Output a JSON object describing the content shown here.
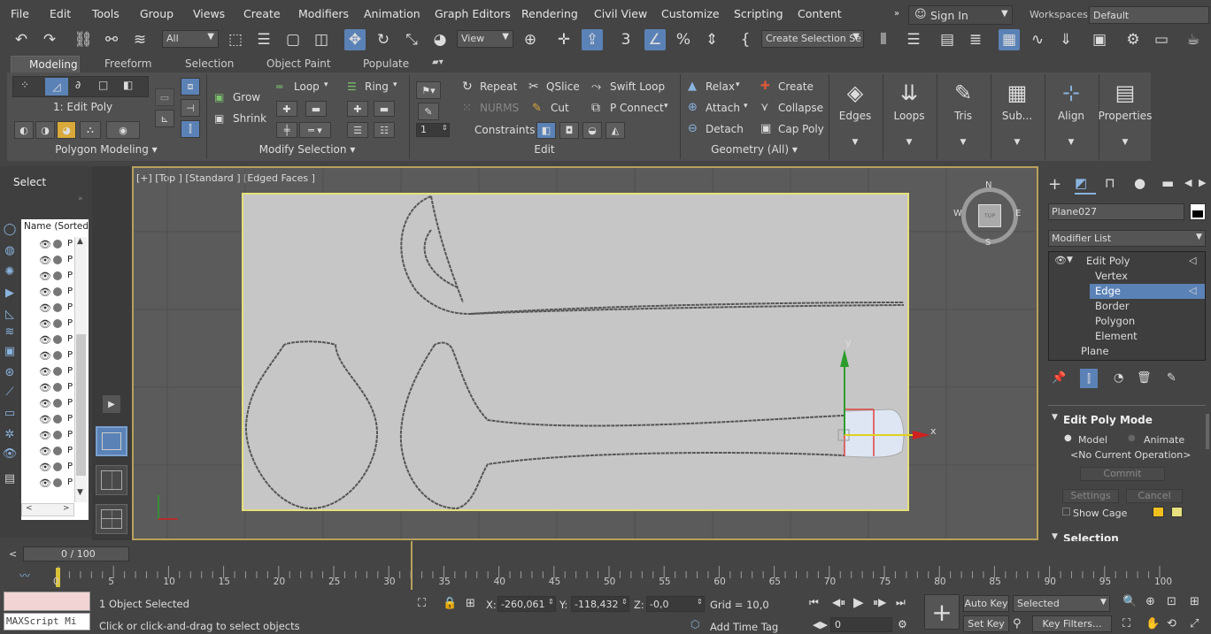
{
  "menu": [
    "File",
    "Edit",
    "Tools",
    "Group",
    "Views",
    "Create",
    "Modifiers",
    "Animation",
    "Graph Editors",
    "Rendering",
    "Civil View",
    "Customize",
    "Scripting",
    "Content"
  ],
  "account": {
    "sign_in": "Sign In",
    "workspaces_label": "Workspaces:",
    "workspaces_value": "Default"
  },
  "toolbar": {
    "filter": "All",
    "view": "View",
    "selection_set": "Create Selection Se"
  },
  "ribbon_tabs": [
    "Modeling",
    "Freeform",
    "Selection",
    "Object Paint",
    "Populate"
  ],
  "ribbon": {
    "edit_poly_label": "1: Edit Poly",
    "polygon_modeling": "Polygon Modeling",
    "grow": "Grow",
    "shrink": "Shrink",
    "loop": "Loop",
    "ring": "Ring",
    "modify_selection": "Modify Selection",
    "repeat": "Repeat",
    "qslice": "QSlice",
    "swift_loop": "Swift Loop",
    "nurms": "NURMS",
    "cut": "Cut",
    "p_connect": "P Connect",
    "constraints": "Constraints:",
    "edit_footer": "Edit",
    "relax": "Relax",
    "create": "Create",
    "attach": "Attach",
    "collapse": "Collapse",
    "detach": "Detach",
    "cap_poly": "Cap Poly",
    "geometry_all": "Geometry (All)",
    "spinner_value": "1",
    "big_tools": [
      "Edges",
      "Loops",
      "Tris",
      "Sub...",
      "Align",
      "Properties"
    ]
  },
  "left": {
    "select": "Select",
    "explorer_header": "Name (Sorted A",
    "item_prefix": "P"
  },
  "viewport": {
    "label": "[+] [Top ] [Standard ] [Edged Faces ]",
    "compass": {
      "n": "N",
      "s": "S",
      "e": "E",
      "w": "W",
      "top": "TOP"
    },
    "gizmo": {
      "x": "x",
      "y": "y"
    }
  },
  "command_panel": {
    "object_name": "Plane027",
    "modifier_list": "Modifier List",
    "stack": [
      "Edit Poly",
      "Vertex",
      "Edge",
      "Border",
      "Polygon",
      "Element",
      "Plane"
    ],
    "edit_poly_mode": "Edit Poly Mode",
    "model": "Model",
    "animate": "Animate",
    "no_op": "<No Current Operation>",
    "commit": "Commit",
    "settings": "Settings",
    "cancel": "Cancel",
    "show_cage": "Show Cage",
    "selection": "Selection"
  },
  "timeline": {
    "frame": "0 / 100",
    "ticks": [
      "0",
      "5",
      "10",
      "15",
      "20",
      "25",
      "30",
      "35",
      "40",
      "45",
      "50",
      "55",
      "60",
      "65",
      "70",
      "75",
      "80",
      "85",
      "90",
      "95",
      "100"
    ]
  },
  "status": {
    "script": "MAXScript Mi",
    "selected": "1 Object Selected",
    "hint": "Click or click-and-drag to select objects",
    "x_label": "X:",
    "x": "-260,061",
    "y_label": "Y:",
    "y": "-118,432",
    "z_label": "Z:",
    "z": "-0,0",
    "grid": "Grid = 10,0",
    "add_time_tag": "Add Time Tag",
    "auto_key": "Auto Key",
    "selected_dd": "Selected",
    "set_key": "Set Key",
    "key_filters": "Key Filters...",
    "frame_field": "0"
  },
  "colors": {
    "accent": "#5b82b6",
    "viewport_border": "#b8a05c",
    "plane": "#c6c6c6",
    "plane_border": "#e6e07a"
  }
}
